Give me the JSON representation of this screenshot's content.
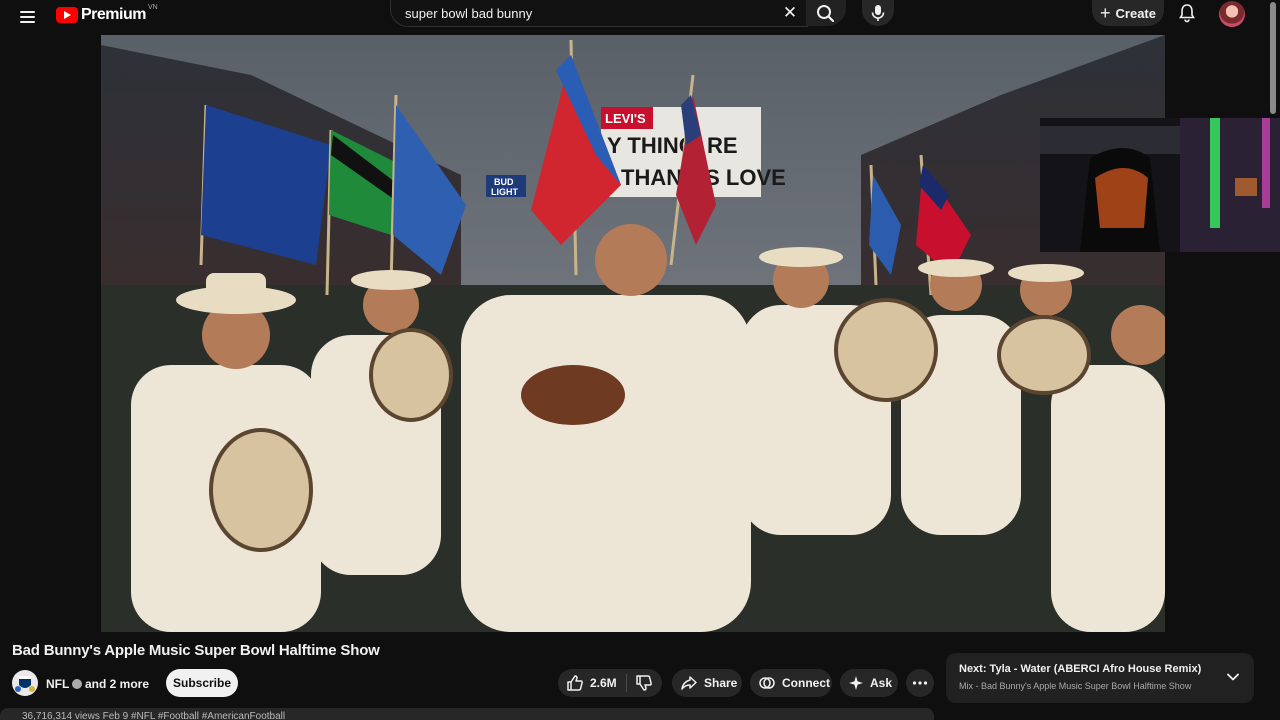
{
  "header": {
    "brand": "Premium",
    "country_code": "VN",
    "search": {
      "value": "super bowl bad bunny",
      "placeholder": "Search"
    },
    "create_label": "Create",
    "icons": [
      "menu-icon",
      "youtube-logo-icon",
      "search-icon",
      "close-icon",
      "mic-icon",
      "plus-icon",
      "bell-icon"
    ]
  },
  "video": {
    "title": "Bad Bunny's Apple Music Super Bowl Halftime Show",
    "scene_signs": [
      "LEVI'S",
      "Y THING",
      "RE",
      "THAN",
      "IS LOVE",
      "BUD",
      "LIGHT"
    ]
  },
  "channel": {
    "name": "NFL",
    "collab_label": "and 2 more",
    "subscribe_label": "Subscribe"
  },
  "actions": {
    "like_count": "2.6M",
    "share_label": "Share",
    "connect_label": "Connect",
    "ask_label": "Ask"
  },
  "up_next": {
    "title": "Next: Tyla - Water (ABERCI Afro House Remix)",
    "subtitle": "Mix - Bad Bunny's Apple Music Super Bowl Halftime Show"
  },
  "description": {
    "preview": "36,716,314 views  Feb 9  #NFL #Football #AmericanFootball"
  },
  "colors": {
    "background": "#0f0f0f",
    "brand_red": "#ff0000",
    "pill": "#272727",
    "text": "#f1f1f1",
    "secondary_text": "#aaaaaa"
  }
}
